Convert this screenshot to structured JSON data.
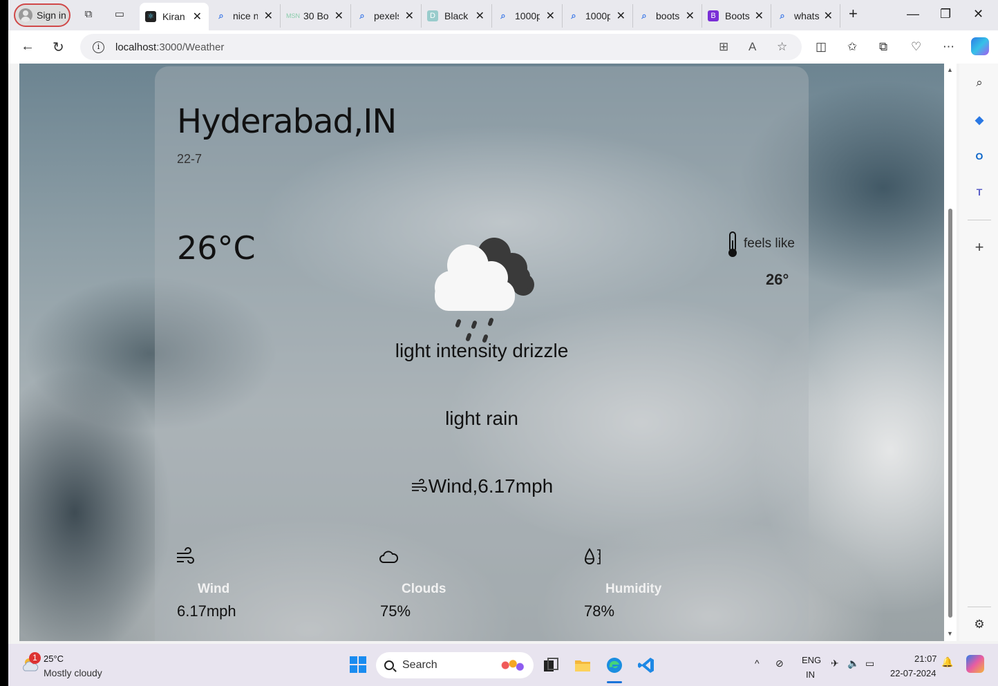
{
  "browser": {
    "signin_label": "Sign in",
    "tabs": [
      {
        "title": "Kiran",
        "icon": "react-icon",
        "active": true
      },
      {
        "title": "nice n",
        "icon": "search-icon"
      },
      {
        "title": "30 Bo",
        "icon": "msn-icon"
      },
      {
        "title": "pexels",
        "icon": "search-icon"
      },
      {
        "title": "Black",
        "icon": "document-icon"
      },
      {
        "title": "1000p",
        "icon": "search-icon"
      },
      {
        "title": "1000p",
        "icon": "search-icon"
      },
      {
        "title": "boots",
        "icon": "search-icon"
      },
      {
        "title": "Boots",
        "icon": "bootstrap-icon"
      },
      {
        "title": "whats",
        "icon": "search-icon"
      }
    ],
    "address_host": "localhost",
    "address_path": ":3000/Weather"
  },
  "weather": {
    "city": "Hyderabad,IN",
    "date": "22-7",
    "temperature": "26°C",
    "feels_like_label": "feels like",
    "feels_like_value": "26°",
    "description": "light intensity drizzle",
    "main": "light rain",
    "wind_line": "Wind,6.17mph",
    "stats": [
      {
        "label": "Wind",
        "value": "6.17mph",
        "icon": "wind-icon"
      },
      {
        "label": "Clouds",
        "value": "75%",
        "icon": "cloud-icon"
      },
      {
        "label": "Humidity",
        "value": "78%",
        "icon": "humidity-icon"
      }
    ]
  },
  "taskbar": {
    "weather_temp": "25°C",
    "weather_condition": "Mostly cloudy",
    "notification_count": "1",
    "search_label": "Search",
    "language_top": "ENG",
    "language_bottom": "IN",
    "time": "21:07",
    "date": "22-07-2024"
  }
}
